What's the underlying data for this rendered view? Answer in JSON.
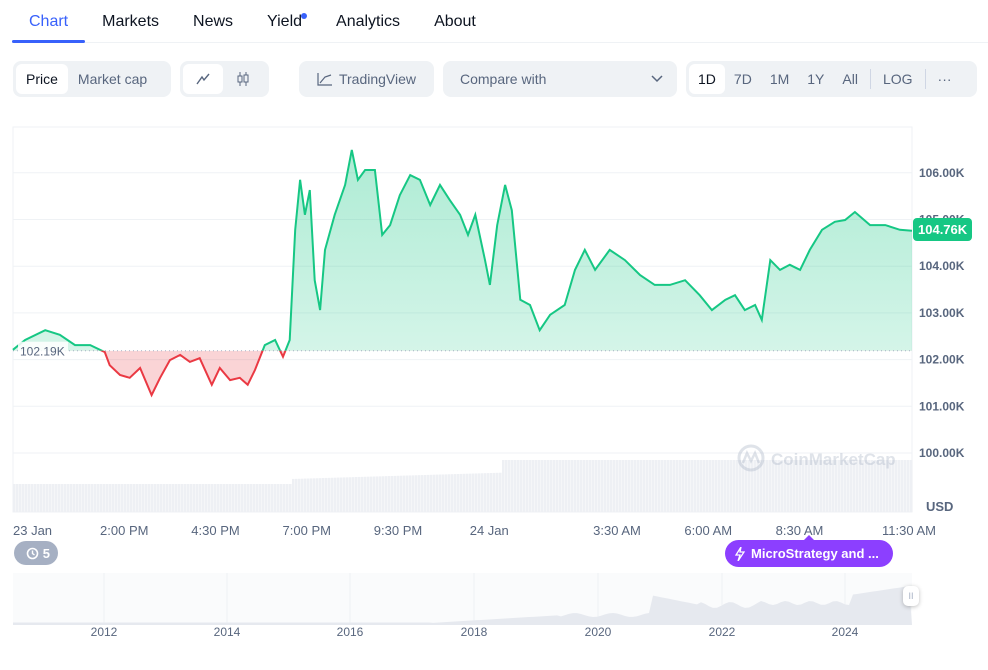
{
  "tabs": [
    {
      "label": "Chart",
      "active": true
    },
    {
      "label": "Markets"
    },
    {
      "label": "News"
    },
    {
      "label": "Yield",
      "dot": true
    },
    {
      "label": "Analytics"
    },
    {
      "label": "About"
    }
  ],
  "toolbar": {
    "price": "Price",
    "market_cap": "Market cap",
    "line_icon": "line-chart-icon",
    "candle_icon": "candlestick-icon",
    "tradingview": "TradingView",
    "compare_placeholder": "Compare with",
    "ranges": [
      "1D",
      "7D",
      "1M",
      "1Y",
      "All"
    ],
    "active_range": "1D",
    "log": "LOG",
    "more": "···"
  },
  "colors": {
    "up": "#16c784",
    "down": "#ea3943",
    "accent": "#3861fb",
    "news": "#8c3fff"
  },
  "chart_data": {
    "type": "area",
    "baseline": 102.19,
    "baseline_label": "102.19K",
    "current_label": "104.76K",
    "currency": "USD",
    "ylim": [
      99.4,
      107.1
    ],
    "yticks": [
      "106.00K",
      "105.00K",
      "104.00K",
      "103.00K",
      "102.00K",
      "101.00K",
      "100.00K"
    ],
    "ytick_values": [
      106,
      105,
      104,
      103,
      102,
      101,
      100
    ],
    "xticks": [
      {
        "label": "23 Jan",
        "t": "23 Jan 11:30"
      },
      {
        "label": "2:00 PM",
        "t": "23 Jan 14:00"
      },
      {
        "label": "4:30 PM",
        "t": "23 Jan 16:30"
      },
      {
        "label": "7:00 PM",
        "t": "23 Jan 19:00"
      },
      {
        "label": "9:30 PM",
        "t": "23 Jan 21:30"
      },
      {
        "label": "24 Jan",
        "t": "24 Jan 00:00"
      },
      {
        "label": "3:30 AM",
        "t": "24 Jan 03:30"
      },
      {
        "label": "6:00 AM",
        "t": "24 Jan 06:00"
      },
      {
        "label": "8:30 AM",
        "t": "24 Jan 08:30"
      },
      {
        "label": "11:30 AM",
        "t": "24 Jan 11:30"
      }
    ],
    "price_k": [
      [
        "23 Jan 10:57",
        102.21
      ],
      [
        "23 Jan 11:17",
        102.42
      ],
      [
        "23 Jan 11:50",
        102.63
      ],
      [
        "23 Jan 12:14",
        102.53
      ],
      [
        "23 Jan 12:39",
        102.31
      ],
      [
        "23 Jan 13:04",
        102.31
      ],
      [
        "23 Jan 13:28",
        102.16
      ],
      [
        "23 Jan 13:36",
        101.88
      ],
      [
        "23 Jan 13:53",
        101.67
      ],
      [
        "23 Jan 14:09",
        101.61
      ],
      [
        "23 Jan 14:26",
        101.82
      ],
      [
        "23 Jan 14:45",
        101.24
      ],
      [
        "23 Jan 14:59",
        101.61
      ],
      [
        "23 Jan 15:15",
        101.99
      ],
      [
        "23 Jan 15:32",
        102.1
      ],
      [
        "23 Jan 15:48",
        101.95
      ],
      [
        "23 Jan 16:04",
        102.03
      ],
      [
        "23 Jan 16:24",
        101.46
      ],
      [
        "23 Jan 16:37",
        101.82
      ],
      [
        "23 Jan 16:54",
        101.56
      ],
      [
        "23 Jan 17:10",
        101.61
      ],
      [
        "23 Jan 17:23",
        101.46
      ],
      [
        "23 Jan 17:35",
        101.78
      ],
      [
        "23 Jan 17:51",
        102.31
      ],
      [
        "23 Jan 18:08",
        102.42
      ],
      [
        "23 Jan 18:21",
        102.06
      ],
      [
        "23 Jan 18:32",
        102.42
      ],
      [
        "23 Jan 18:41",
        104.78
      ],
      [
        "23 Jan 18:49",
        105.85
      ],
      [
        "23 Jan 18:57",
        105.1
      ],
      [
        "23 Jan 19:05",
        105.63
      ],
      [
        "23 Jan 19:13",
        103.7
      ],
      [
        "23 Jan 19:22",
        103.06
      ],
      [
        "23 Jan 19:30",
        104.35
      ],
      [
        "23 Jan 19:46",
        105.1
      ],
      [
        "23 Jan 20:03",
        105.74
      ],
      [
        "23 Jan 20:14",
        106.49
      ],
      [
        "23 Jan 20:24",
        105.85
      ],
      [
        "23 Jan 20:36",
        106.06
      ],
      [
        "23 Jan 20:52",
        106.06
      ],
      [
        "23 Jan 21:04",
        104.67
      ],
      [
        "23 Jan 21:17",
        104.88
      ],
      [
        "23 Jan 21:33",
        105.52
      ],
      [
        "23 Jan 21:50",
        105.95
      ],
      [
        "23 Jan 22:06",
        105.85
      ],
      [
        "23 Jan 22:23",
        105.31
      ],
      [
        "23 Jan 22:39",
        105.74
      ],
      [
        "23 Jan 22:55",
        105.42
      ],
      [
        "23 Jan 23:12",
        105.1
      ],
      [
        "23 Jan 23:25",
        104.67
      ],
      [
        "23 Jan 23:37",
        105.1
      ],
      [
        "23 Jan 23:53",
        104.13
      ],
      [
        "24 Jan 00:01",
        103.6
      ],
      [
        "24 Jan 00:13",
        104.88
      ],
      [
        "24 Jan 00:26",
        105.74
      ],
      [
        "24 Jan 00:37",
        105.2
      ],
      [
        "24 Jan 00:51",
        103.28
      ],
      [
        "24 Jan 01:07",
        103.17
      ],
      [
        "24 Jan 01:23",
        102.63
      ],
      [
        "24 Jan 01:40",
        102.96
      ],
      [
        "24 Jan 02:04",
        103.17
      ],
      [
        "24 Jan 02:21",
        103.92
      ],
      [
        "24 Jan 02:37",
        104.35
      ],
      [
        "24 Jan 02:54",
        103.92
      ],
      [
        "24 Jan 03:18",
        104.35
      ],
      [
        "24 Jan 03:43",
        104.13
      ],
      [
        "24 Jan 04:08",
        103.81
      ],
      [
        "24 Jan 04:32",
        103.6
      ],
      [
        "24 Jan 04:57",
        103.6
      ],
      [
        "24 Jan 05:22",
        103.7
      ],
      [
        "24 Jan 05:46",
        103.38
      ],
      [
        "24 Jan 06:06",
        103.06
      ],
      [
        "24 Jan 06:28",
        103.28
      ],
      [
        "24 Jan 06:44",
        103.38
      ],
      [
        "24 Jan 07:00",
        103.06
      ],
      [
        "24 Jan 07:17",
        103.17
      ],
      [
        "24 Jan 07:28",
        102.85
      ],
      [
        "24 Jan 07:42",
        104.13
      ],
      [
        "24 Jan 07:58",
        103.92
      ],
      [
        "24 Jan 08:14",
        104.03
      ],
      [
        "24 Jan 08:31",
        103.92
      ],
      [
        "24 Jan 08:47",
        104.35
      ],
      [
        "24 Jan 09:07",
        104.78
      ],
      [
        "24 Jan 09:28",
        104.95
      ],
      [
        "24 Jan 09:45",
        104.99
      ],
      [
        "24 Jan 10:01",
        105.16
      ],
      [
        "24 Jan 10:26",
        104.88
      ],
      [
        "24 Jan 10:51",
        104.88
      ],
      [
        "24 Jan 11:15",
        104.78
      ],
      [
        "24 Jan 11:35",
        104.76
      ]
    ],
    "navigator_years": [
      "2012",
      "2014",
      "2016",
      "2018",
      "2020",
      "2022",
      "2024"
    ]
  },
  "watermark": "CoinMarketCap",
  "history_count": "5",
  "news_label": "MicroStrategy and ...",
  "history_icon": "history-icon",
  "news_icon": "lightning-icon"
}
